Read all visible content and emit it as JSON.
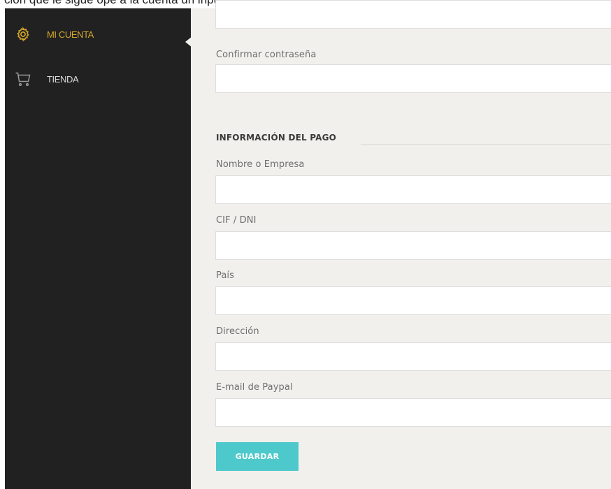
{
  "caption": "ción que le sigue ope a la cuenta un inpute agregar los datos necesarios",
  "sidebar": {
    "items": [
      {
        "label": "MI CUENTA",
        "icon": "gear-icon",
        "active": true
      },
      {
        "label": "TIENDA",
        "icon": "cart-icon",
        "active": false
      }
    ]
  },
  "form": {
    "password": {
      "value": ""
    },
    "confirm_password": {
      "label": "Confirmar contraseña",
      "value": ""
    },
    "payment_section_title": "INFORMACIÓN DEL PAGO",
    "company_name": {
      "label": "Nombre o Empresa",
      "value": ""
    },
    "tax_id": {
      "label": "CIF / DNI",
      "value": ""
    },
    "country": {
      "label": "País",
      "value": ""
    },
    "address": {
      "label": "Dirección",
      "value": ""
    },
    "paypal_email": {
      "label": "E-mail de Paypal",
      "value": ""
    },
    "save_label": "GUARDAR"
  },
  "colors": {
    "sidebar_bg": "#212121",
    "active_item": "#d4a72c",
    "content_bg": "#f1f0ec",
    "save_button": "#4dc9cb"
  }
}
